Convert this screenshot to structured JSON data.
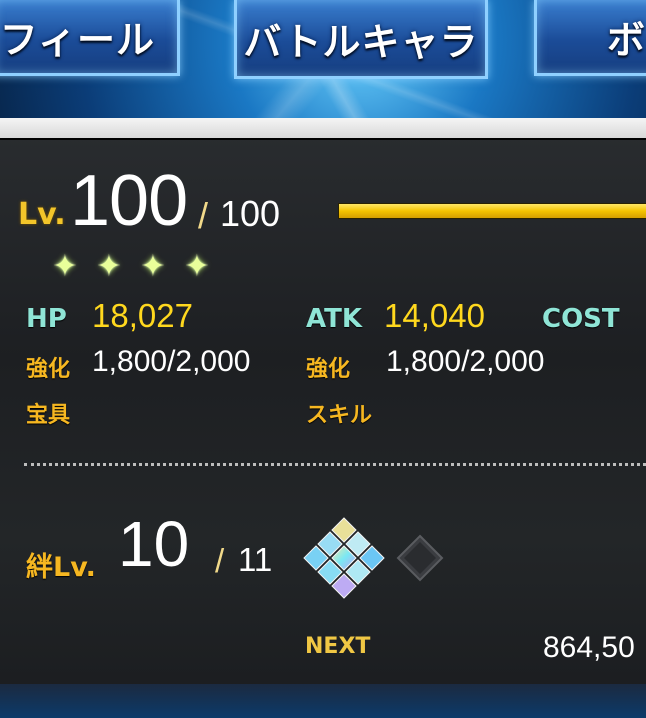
{
  "tabs": [
    {
      "label": "ロフィール"
    },
    {
      "label": "バトルキャラ"
    },
    {
      "label": "ボ"
    }
  ],
  "level": {
    "label": "Lv.",
    "current": "100",
    "slash": "/",
    "max": "100",
    "progress": 1.0
  },
  "rarity_stars": 4,
  "stats": {
    "hp": {
      "label": "HP",
      "value": "18,027"
    },
    "atk": {
      "label": "ATK",
      "value": "14,040"
    },
    "cost": {
      "label": "COST"
    },
    "hp_enhance": {
      "label": "強化",
      "value": "1,800/2,000"
    },
    "atk_enhance": {
      "label": "強化",
      "value": "1,800/2,000"
    },
    "noble_phantasm": {
      "label": "宝具"
    },
    "skill": {
      "label": "スキル"
    }
  },
  "bond": {
    "label": "絆Lv.",
    "current": "10",
    "slash": "/",
    "max": "11",
    "next_label": "NEXT",
    "next_value": "864,50"
  },
  "colors": {
    "accent_gold": "#f3c52a",
    "stat_yellow": "#ffd81e",
    "stat_cyan": "#8fe5d6"
  }
}
